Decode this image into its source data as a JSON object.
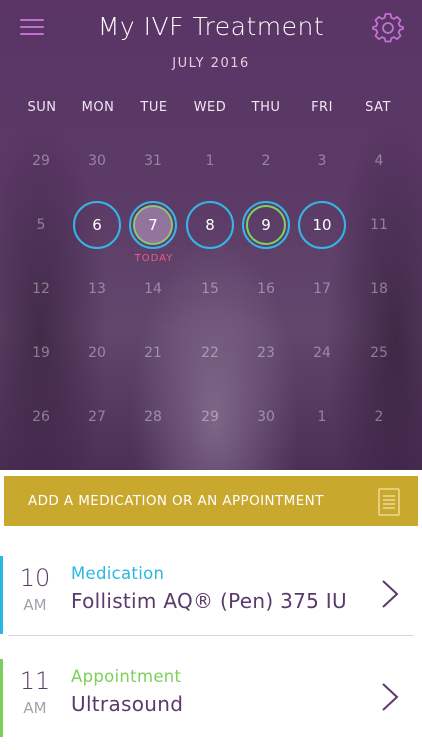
{
  "app": {
    "title": "My IVF Treatment"
  },
  "calendar": {
    "month_label": "JULY 2016",
    "weekdays": [
      "SUN",
      "MON",
      "TUE",
      "WED",
      "THU",
      "FRI",
      "SAT"
    ],
    "weeks": [
      [
        "29",
        "30",
        "31",
        "1",
        "2",
        "3",
        "4"
      ],
      [
        "5",
        "6",
        "7",
        "8",
        "9",
        "10",
        "11"
      ],
      [
        "12",
        "13",
        "14",
        "15",
        "16",
        "17",
        "18"
      ],
      [
        "19",
        "20",
        "21",
        "22",
        "23",
        "24",
        "25"
      ],
      [
        "26",
        "27",
        "28",
        "29",
        "30",
        "1",
        "2"
      ]
    ],
    "today_label": "TODAY"
  },
  "add_action": {
    "label": "ADD A MEDICATION OR AN APPOINTMENT",
    "icon": "document-icon"
  },
  "schedule": [
    {
      "hour": "10",
      "ampm": "AM",
      "type": "Medication",
      "name": "Follistim AQ® (Pen) 375 IU",
      "color": "#2bb7e3"
    },
    {
      "hour": "11",
      "ampm": "AM",
      "type": "Appointment",
      "name": "Ultrasound",
      "color": "#7ccf5a"
    }
  ],
  "colors": {
    "menu": "#c46fd3",
    "medication_ring": "#34b6e8",
    "appointment_ring": "#7ed35b",
    "today": "#f05a86",
    "add_bar": "#c9a82e",
    "text_primary": "#5a3a6a"
  }
}
